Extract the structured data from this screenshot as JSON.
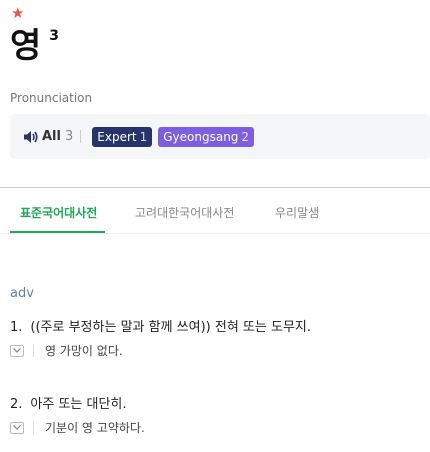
{
  "entry": {
    "star": "★",
    "word": "영",
    "homograph_number": "3"
  },
  "pronunciation": {
    "label": "Pronunciation",
    "all_label": "All",
    "all_count": "3",
    "badges": [
      {
        "label": "Expert",
        "count": "1",
        "color": "#27346b"
      },
      {
        "label": "Gyeongsang",
        "count": "2",
        "color": "#7d5ee0"
      }
    ]
  },
  "tabs": [
    {
      "label": "표준국어대사전",
      "active": true
    },
    {
      "label": "고려대한국어대사전",
      "active": false
    },
    {
      "label": "우리말샘",
      "active": false
    }
  ],
  "colors": {
    "accent_green": "#1ea85a",
    "pos_blue": "#5b7fb5",
    "star_red": "#e05a4e"
  },
  "definitions": {
    "part_of_speech": "adv",
    "senses": [
      {
        "number": "1.",
        "text": "((주로 부정하는 말과 함께 쓰여)) 전혀 또는 도무지.",
        "example": "영 가망이 없다."
      },
      {
        "number": "2.",
        "text": "아주 또는 대단히.",
        "example": "기분이 영 고약하다."
      }
    ]
  }
}
